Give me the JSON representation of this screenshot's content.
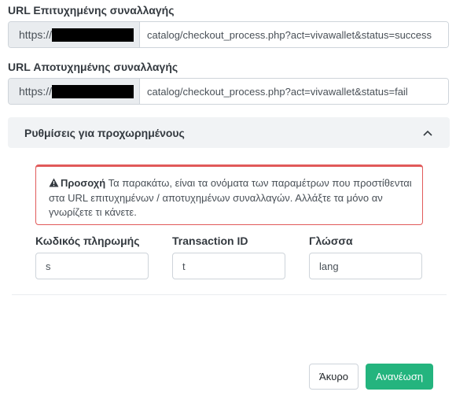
{
  "success_url": {
    "label": "URL Επιτυχημένης συναλλαγής",
    "prefix": "https://",
    "value": "catalog/checkout_process.php?act=vivawallet&status=success"
  },
  "fail_url": {
    "label": "URL Αποτυχημένης συναλλαγής",
    "prefix": "https://",
    "value": "catalog/checkout_process.php?act=vivawallet&status=fail"
  },
  "advanced": {
    "title": "Ρυθμίσεις για προχωρημένους",
    "toggle_icon": "chevron-up-icon",
    "alert": {
      "icon": "warning-icon",
      "strong": "Προσοχή",
      "text": "Τα παρακάτω, είναι τα ονόματα των παραμέτρων που προστίθενται στα URL επιτυχημένων / αποτυχημένων συναλλαγών. Αλλάξτε τα μόνο αν γνωρίζετε τι κάνετε."
    },
    "fields": [
      {
        "label": "Κωδικός πληρωμής",
        "value": "s"
      },
      {
        "label": "Transaction ID",
        "value": "t"
      },
      {
        "label": "Γλώσσα",
        "value": "lang"
      }
    ]
  },
  "buttons": {
    "cancel": "Άκυρο",
    "update": "Ανανέωση"
  },
  "colors": {
    "accent": "#24b47e",
    "alert_border": "#e15a5a",
    "redaction": "#000000"
  }
}
